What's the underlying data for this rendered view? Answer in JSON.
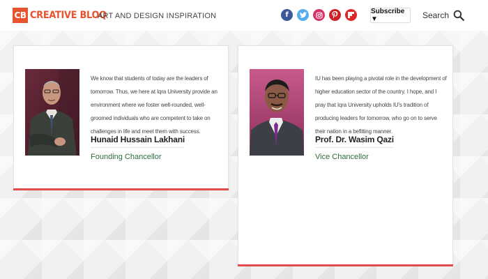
{
  "header": {
    "logo_badge": "CB",
    "logo_text": "CREATIVE BLOQ",
    "tagline": "ART AND DESIGN INSPIRATION",
    "socials": [
      {
        "name": "facebook-icon",
        "glyph": "f",
        "color": "#3b5998"
      },
      {
        "name": "twitter-icon",
        "glyph": "t",
        "color": "#55acee"
      },
      {
        "name": "instagram-icon",
        "glyph": "◎",
        "color": "#d6336c"
      },
      {
        "name": "pinterest-icon",
        "glyph": "p",
        "color": "#cb2027"
      },
      {
        "name": "flipboard-icon",
        "glyph": "f",
        "color": "#e12828"
      }
    ],
    "subscribe_label": "Subscribe ▼",
    "search_label": "Search"
  },
  "cards": [
    {
      "quote": "We know that students of today are the leaders of tomorrow. Thus, we here at Iqra University provide an environment where we foster well-rounded, well-groomed individuals who are competent to take on challenges in life and meet them with success.",
      "name": "Hunaid Hussain Lakhani",
      "title": "Founding Chancellor"
    },
    {
      "quote": "IU has been playing a pivotal role in the development of higher education sector of the country. I hope, and I pray that Iqra University upholds IU's tradition of producing leaders for tomorrow, who go on to serve their nation in a befitting manner.",
      "name": "Prof. Dr. Wasim Qazi",
      "title": "Vice Chancellor"
    }
  ],
  "colors": {
    "brand": "#e8542f",
    "accent_line": "#e24b4b",
    "title_green": "#2e6b3d"
  }
}
